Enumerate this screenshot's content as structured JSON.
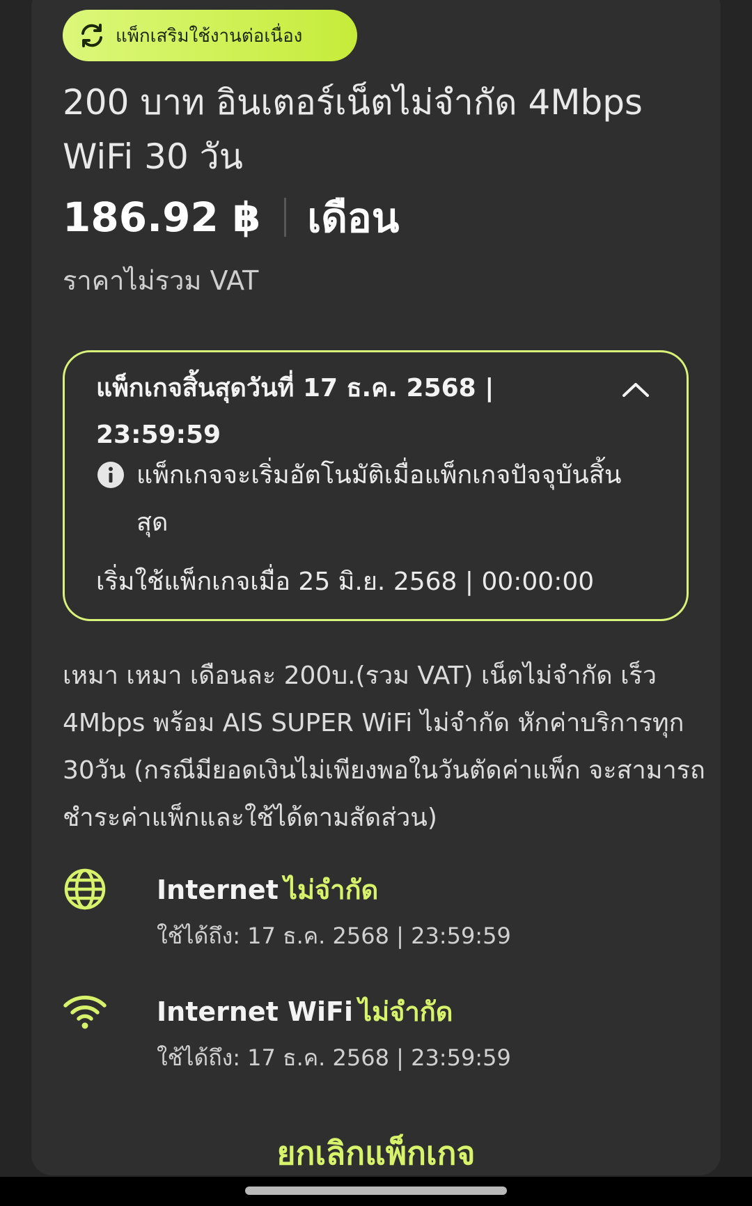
{
  "package": {
    "badge_label": "แพ็กเสริมใช้งานต่อเนื่อง",
    "badge_icon": "refresh-icon",
    "title": "200 บาท อินเตอร์เน็ตไม่จำกัด 4Mbps WiFi 30 วัน",
    "price": "186.92 ฿",
    "period": "เดือน",
    "vat_note": "ราคาไม่รวม VAT"
  },
  "schedule": {
    "expiry": "แพ็กเกจสิ้นสุดวันที่ 17 ธ.ค. 2568 | 23:59:59",
    "expanded_icon": "chevron-up-icon",
    "auto_renew_note": "แพ็กเกจจะเริ่มอัตโนมัติเมื่อแพ็กเกจปัจจุบันสิ้นสุด",
    "start": "เริ่มใช้แพ็กเกจเมื่อ 25 มิ.ย. 2568 | 00:00:00"
  },
  "description": "เหมา เหมา เดือนละ 200บ.(รวม VAT) เน็ตไม่จำกัด เร็ว 4Mbps พร้อม AIS SUPER WiFi ไม่จำกัด หักค่าบริการทุก 30วัน (กรณีมียอดเงินไม่เพียงพอในวันตัดค่าแพ็ก จะสามารถชำระค่าแพ็กและใช้ได้ตามสัดส่วน)",
  "benefits": [
    {
      "icon": "globe-icon",
      "name": "Internet",
      "quota": "ไม่จำกัด",
      "valid_until": "ใช้ได้ถึง: 17 ธ.ค. 2568 | 23:59:59"
    },
    {
      "icon": "wifi-icon",
      "name": "Internet WiFi",
      "quota": "ไม่จำกัด",
      "valid_until": "ใช้ได้ถึง: 17 ธ.ค. 2568 | 23:59:59"
    }
  ],
  "actions": {
    "cancel_label": "ยกเลิกแพ็กเกจ"
  },
  "colors": {
    "accent": "#d7f26b",
    "background": "#252525",
    "card": "#2f2f2f"
  }
}
